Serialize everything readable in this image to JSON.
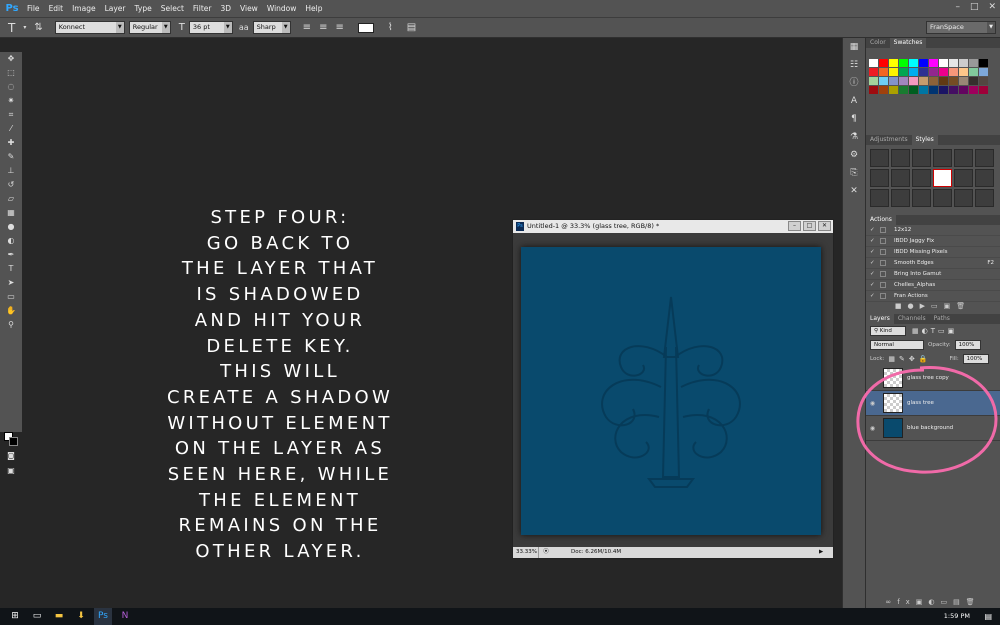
{
  "menubar": {
    "logo": "Ps",
    "items": [
      "File",
      "Edit",
      "Image",
      "Layer",
      "Type",
      "Select",
      "Filter",
      "3D",
      "View",
      "Window",
      "Help"
    ]
  },
  "options": {
    "font_family": "Konnect",
    "font_style": "Regular",
    "font_size": "36 pt",
    "antialias": "Sharp",
    "workspace": "FranSpace"
  },
  "caption": {
    "lines": [
      "STEP FOUR:",
      "GO BACK TO",
      "THE LAYER THAT",
      "IS SHADOWED",
      "AND HIT YOUR",
      "DELETE KEY.",
      "THIS WILL",
      "CREATE A SHADOW",
      "WITHOUT ELEMENT",
      "ON THE LAYER AS",
      "SEEN HERE, WHILE",
      "THE ELEMENT",
      "REMAINS ON THE",
      "OTHER LAYER."
    ]
  },
  "document": {
    "title": "Untitled-1 @ 33.3% (glass tree, RGB/8) *",
    "zoom": "33.33%",
    "doc_size": "Doc: 6.26M/10.4M",
    "canvas_color": "#094a6d"
  },
  "swatches_panel": {
    "tabs": [
      "Color",
      "Swatches"
    ],
    "colors": [
      "#ffffff",
      "#ff0000",
      "#ffff00",
      "#00ff00",
      "#00ffff",
      "#0000ff",
      "#ff00ff",
      "#ffffff",
      "#e6e6e6",
      "#cccccc",
      "#999999",
      "#000000",
      "#ed1c24",
      "#f26522",
      "#fff200",
      "#00a651",
      "#00aeef",
      "#2e3192",
      "#92278f",
      "#ec008c",
      "#f7977a",
      "#fdc689",
      "#82ca9c",
      "#7ea7d8",
      "#a3d39c",
      "#6dcff6",
      "#8393ca",
      "#a186be",
      "#f49ac1",
      "#c69c6d",
      "#8c6239",
      "#603913",
      "#754c24",
      "#998675",
      "#362f2d",
      "#534741",
      "#9e0b0f",
      "#a0410d",
      "#aba000",
      "#197b30",
      "#005e20",
      "#0076a3",
      "#003471",
      "#1b1464",
      "#440e62",
      "#630460",
      "#9e005d",
      "#9e0039"
    ]
  },
  "styles_panel": {
    "tabs": [
      "Adjustments",
      "Styles"
    ]
  },
  "actions_panel": {
    "title": "Actions",
    "items": [
      {
        "name": "12x12",
        "shortcut": ""
      },
      {
        "name": "IBDD Jaggy Fix",
        "shortcut": ""
      },
      {
        "name": "IBDD Missing Pixels",
        "shortcut": ""
      },
      {
        "name": "Smooth Edges",
        "shortcut": "F2"
      },
      {
        "name": "Bring Into Gamut",
        "shortcut": ""
      },
      {
        "name": "Chelles_Alphas",
        "shortcut": ""
      },
      {
        "name": "Fran Actions",
        "shortcut": ""
      }
    ]
  },
  "layers_panel": {
    "tabs": [
      "Layers",
      "Channels",
      "Paths"
    ],
    "filter_label": "Kind",
    "blend_mode": "Normal",
    "opacity_label": "Opacity:",
    "opacity_value": "100%",
    "lock_label": "Lock:",
    "fill_label": "Fill:",
    "fill_value": "100%",
    "layers": [
      {
        "name": "glass tree copy",
        "visible": false,
        "selected": false
      },
      {
        "name": "glass tree",
        "visible": true,
        "selected": true
      },
      {
        "name": "blue background",
        "visible": true,
        "selected": false
      }
    ]
  },
  "taskbar": {
    "time": "1:59 PM"
  }
}
